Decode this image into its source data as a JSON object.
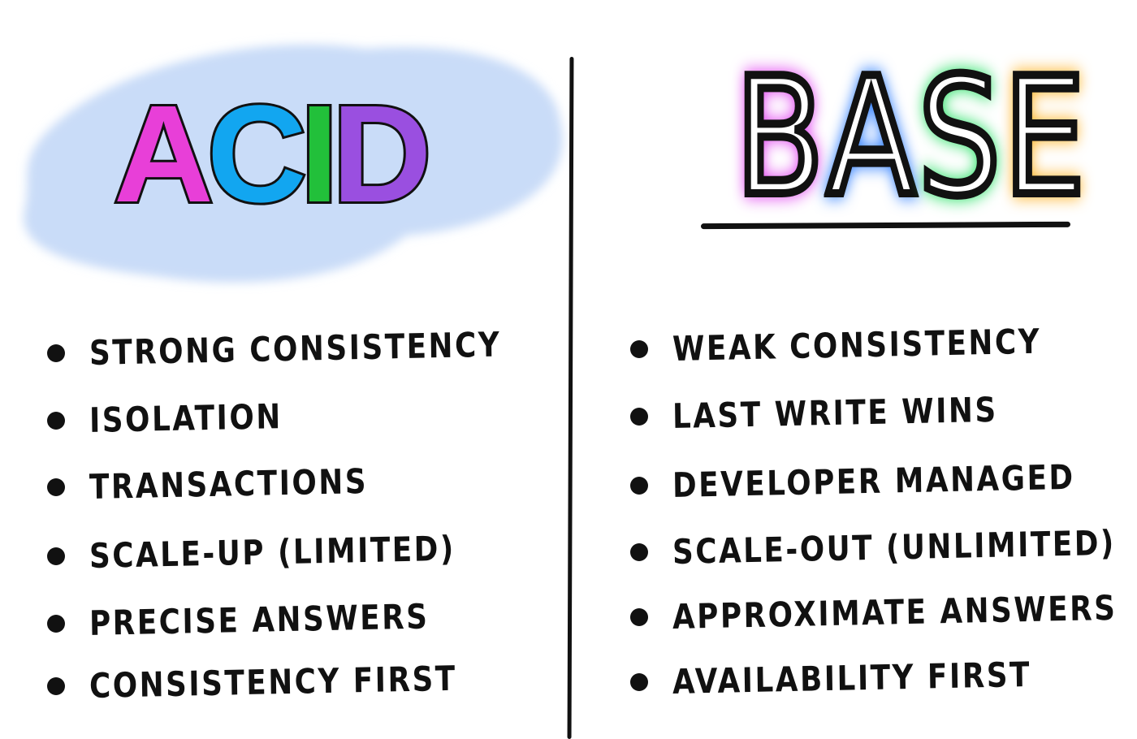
{
  "left": {
    "title": "ACID",
    "title_letters": [
      {
        "char": "A",
        "color": "#e83fd8"
      },
      {
        "char": "C",
        "color": "#12a6f0"
      },
      {
        "char": "I",
        "color": "#22c03a"
      },
      {
        "char": "D",
        "color": "#9a4fe0"
      }
    ],
    "background_color": "#c9dcf8",
    "items": [
      "STRONG CONSISTENCY",
      "ISOLATION",
      "TRANSACTIONS",
      "SCALE-UP (LIMITED)",
      "PRECISE ANSWERS",
      "CONSISTENCY FIRST"
    ]
  },
  "right": {
    "title": "BASE",
    "title_letters": [
      {
        "char": "B",
        "color": "#e040f0"
      },
      {
        "char": "A",
        "color": "#2a7bff"
      },
      {
        "char": "S",
        "color": "#20e060"
      },
      {
        "char": "E",
        "color": "#ffb020"
      }
    ],
    "items": [
      "WEAK CONSISTENCY",
      "LAST WRITE WINS",
      "DEVELOPER MANAGED",
      "SCALE-OUT (UNLIMITED)",
      "APPROXIMATE ANSWERS",
      "AVAILABILITY FIRST"
    ]
  }
}
